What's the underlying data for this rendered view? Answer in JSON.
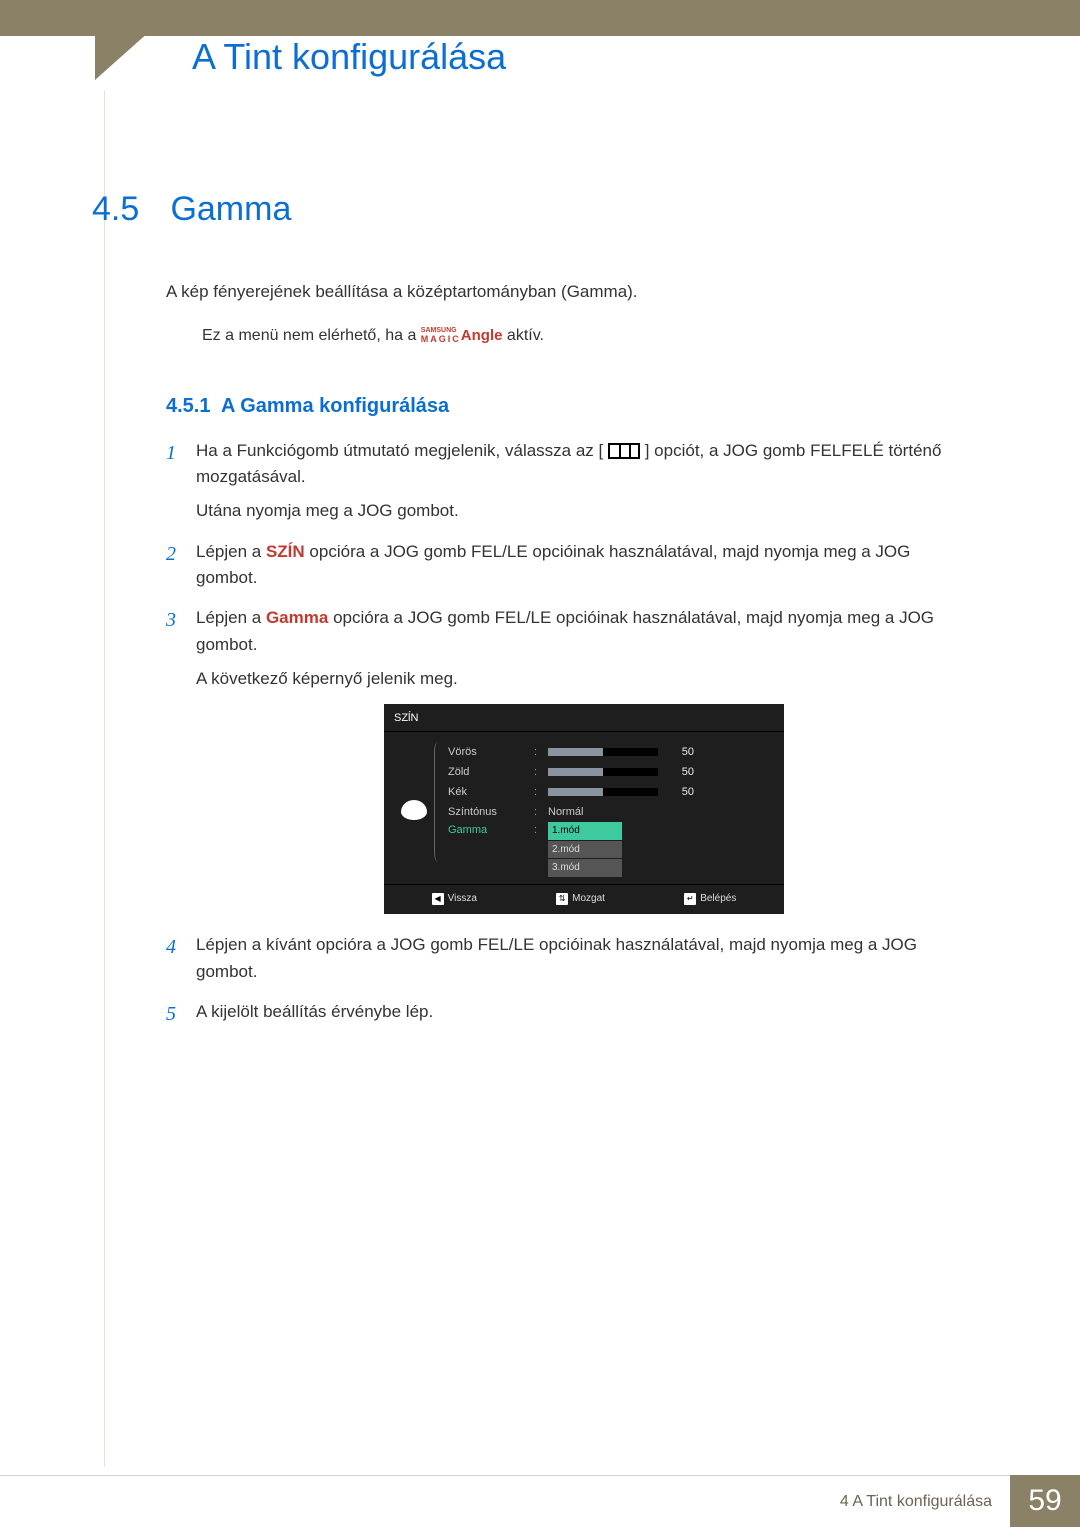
{
  "header": {
    "chapter_title": "A Tint konfigurálása"
  },
  "section": {
    "number": "4.5",
    "title": "Gamma",
    "intro": "A kép fényerejének beállítása a középtartományban (Gamma).",
    "note_prefix": "Ez a menü nem elérhető, ha a ",
    "note_brand_top": "SAMSUNG",
    "note_brand_bot": "MAGIC",
    "note_angle": "Angle",
    "note_suffix": " aktív."
  },
  "subsection": {
    "number": "4.5.1",
    "title": "A Gamma konfigurálása"
  },
  "steps": {
    "s1a_before": "Ha a Funkciógomb útmutató megjelenik, válassza az [",
    "s1a_after": "] opciót, a JOG gomb FELFELÉ történő mozgatásával.",
    "s1b": "Utána nyomja meg a JOG gombot.",
    "s2_before": "Lépjen a ",
    "s2_word": "SZÍN",
    "s2_after": " opcióra a JOG gomb FEL/LE opcióinak használatával, majd nyomja meg a JOG gombot.",
    "s3_before": "Lépjen a ",
    "s3_word": "Gamma",
    "s3_after": " opcióra a JOG gomb FEL/LE opcióinak használatával, majd nyomja meg a JOG gombot.",
    "s3b": "A következő képernyő jelenik meg.",
    "s4": "Lépjen a kívánt opcióra a JOG gomb FEL/LE opcióinak használatával, majd nyomja meg a JOG gombot.",
    "s5": "A kijelölt beállítás érvénybe lép.",
    "n1": "1",
    "n2": "2",
    "n3": "3",
    "n4": "4",
    "n5": "5"
  },
  "osd": {
    "title": "SZĺN",
    "rows": {
      "r1": {
        "label": "Vörös",
        "value": "50",
        "fill": 50
      },
      "r2": {
        "label": "Zöld",
        "value": "50",
        "fill": 50
      },
      "r3": {
        "label": "Kék",
        "value": "50",
        "fill": 50
      },
      "r4": {
        "label": "Színtónus",
        "text": "Normál"
      },
      "r5": {
        "label": "Gamma"
      }
    },
    "options": {
      "o1": "1.mód",
      "o2": "2.mód",
      "o3": "3.mód"
    },
    "footer": {
      "back": "Vissza",
      "move": "Mozgat",
      "enter": "Belépés"
    }
  },
  "footer": {
    "breadcrumb": "4  A Tint konfigurálása",
    "page": "59"
  }
}
